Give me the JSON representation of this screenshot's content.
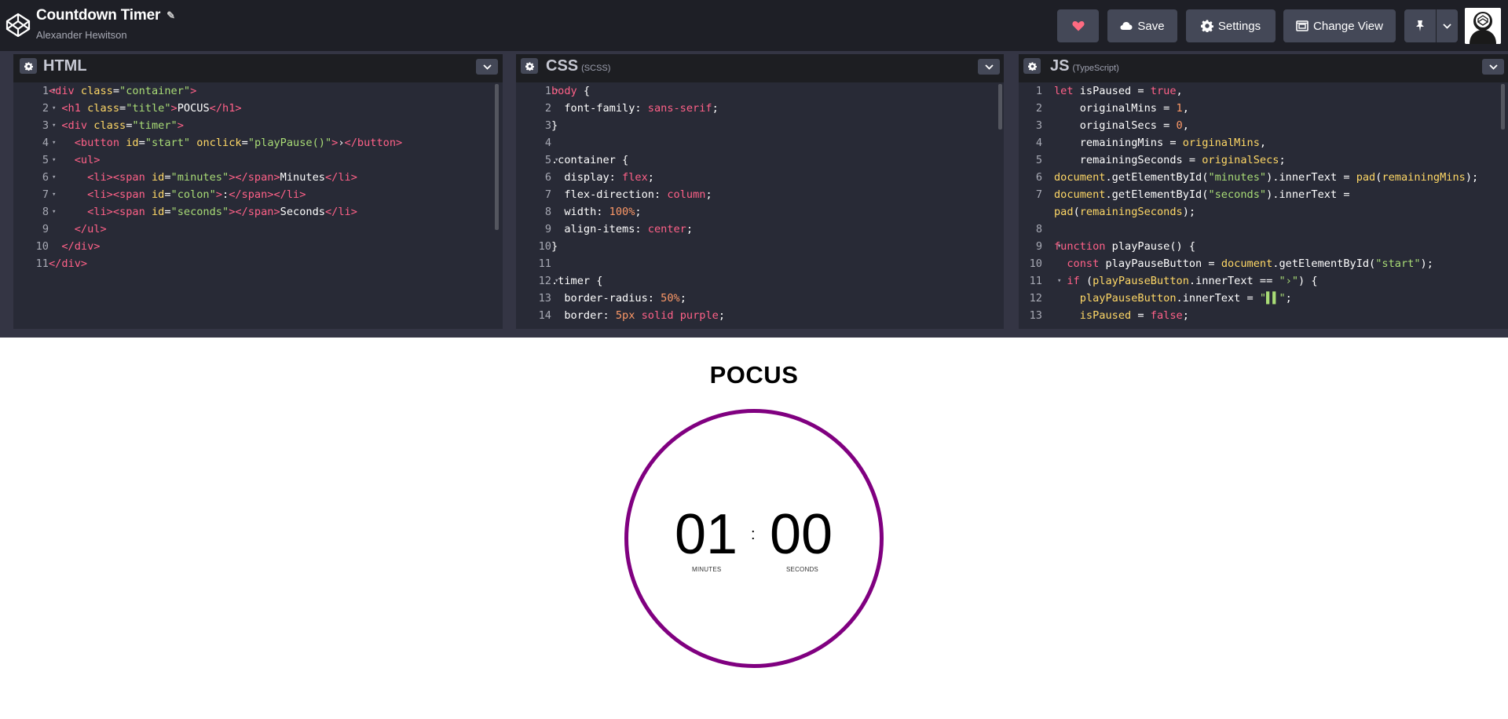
{
  "header": {
    "pen_title": "Countdown Timer",
    "author": "Alexander Hewitson",
    "save_label": "Save",
    "settings_label": "Settings",
    "change_view_label": "Change View",
    "heart_color": "#ff6b81"
  },
  "panes": {
    "html": {
      "name": "HTML",
      "sub": ""
    },
    "css": {
      "name": "CSS",
      "sub": "(SCSS)"
    },
    "js": {
      "name": "JS",
      "sub": "(TypeScript)"
    }
  },
  "html_code": [
    {
      "n": "1",
      "fold": true,
      "segs": [
        [
          "tag",
          "<div "
        ],
        [
          "attr",
          "class"
        ],
        [
          "prop",
          "="
        ],
        [
          "str",
          "\"container\""
        ],
        [
          "tag",
          ">"
        ]
      ]
    },
    {
      "n": "2",
      "fold": true,
      "segs": [
        [
          "prop",
          "  "
        ],
        [
          "tag",
          "<h1 "
        ],
        [
          "attr",
          "class"
        ],
        [
          "prop",
          "="
        ],
        [
          "str",
          "\"title\""
        ],
        [
          "tag",
          ">"
        ],
        [
          "prop",
          "POCUS"
        ],
        [
          "tag",
          "</h1>"
        ]
      ]
    },
    {
      "n": "3",
      "fold": true,
      "segs": [
        [
          "prop",
          "  "
        ],
        [
          "tag",
          "<div "
        ],
        [
          "attr",
          "class"
        ],
        [
          "prop",
          "="
        ],
        [
          "str",
          "\"timer\""
        ],
        [
          "tag",
          ">"
        ]
      ]
    },
    {
      "n": "4",
      "fold": true,
      "segs": [
        [
          "prop",
          "    "
        ],
        [
          "tag",
          "<button "
        ],
        [
          "attr",
          "id"
        ],
        [
          "prop",
          "="
        ],
        [
          "str",
          "\"start\""
        ],
        [
          "prop",
          " "
        ],
        [
          "attr",
          "onclick"
        ],
        [
          "prop",
          "="
        ],
        [
          "str",
          "\"playPause()\""
        ],
        [
          "tag",
          ">"
        ],
        [
          "prop",
          "›"
        ],
        [
          "tag",
          "</button>"
        ]
      ]
    },
    {
      "n": "5",
      "fold": true,
      "segs": [
        [
          "prop",
          "    "
        ],
        [
          "tag",
          "<ul>"
        ]
      ]
    },
    {
      "n": "6",
      "fold": true,
      "segs": [
        [
          "prop",
          "      "
        ],
        [
          "tag",
          "<li><span "
        ],
        [
          "attr",
          "id"
        ],
        [
          "prop",
          "="
        ],
        [
          "str",
          "\"minutes\""
        ],
        [
          "tag",
          "></span>"
        ],
        [
          "prop",
          "Minutes"
        ],
        [
          "tag",
          "</li>"
        ]
      ]
    },
    {
      "n": "7",
      "fold": true,
      "segs": [
        [
          "prop",
          "      "
        ],
        [
          "tag",
          "<li><span "
        ],
        [
          "attr",
          "id"
        ],
        [
          "prop",
          "="
        ],
        [
          "str",
          "\"colon\""
        ],
        [
          "tag",
          ">"
        ],
        [
          "prop",
          ":"
        ],
        [
          "tag",
          "</span></li>"
        ]
      ]
    },
    {
      "n": "8",
      "fold": true,
      "segs": [
        [
          "prop",
          "      "
        ],
        [
          "tag",
          "<li><span "
        ],
        [
          "attr",
          "id"
        ],
        [
          "prop",
          "="
        ],
        [
          "str",
          "\"seconds\""
        ],
        [
          "tag",
          "></span>"
        ],
        [
          "prop",
          "Seconds"
        ],
        [
          "tag",
          "</li>"
        ]
      ]
    },
    {
      "n": "9",
      "fold": false,
      "segs": [
        [
          "prop",
          "    "
        ],
        [
          "tag",
          "</ul>"
        ]
      ]
    },
    {
      "n": "10",
      "fold": false,
      "segs": [
        [
          "prop",
          "  "
        ],
        [
          "tag",
          "</div>"
        ]
      ]
    },
    {
      "n": "11",
      "fold": false,
      "segs": [
        [
          "tag",
          "</div>"
        ]
      ]
    }
  ],
  "css_code": [
    {
      "n": "1",
      "fold": true,
      "segs": [
        [
          "sel",
          "body"
        ],
        [
          "prop",
          " {"
        ]
      ]
    },
    {
      "n": "2",
      "fold": false,
      "segs": [
        [
          "prop",
          "  font-family: "
        ],
        [
          "val",
          "sans-serif"
        ],
        [
          "prop",
          ";"
        ]
      ]
    },
    {
      "n": "3",
      "fold": false,
      "segs": [
        [
          "prop",
          "}"
        ]
      ]
    },
    {
      "n": "4",
      "fold": false,
      "segs": []
    },
    {
      "n": "5",
      "fold": true,
      "segs": [
        [
          "prop",
          ".container {"
        ]
      ]
    },
    {
      "n": "6",
      "fold": false,
      "segs": [
        [
          "prop",
          "  display: "
        ],
        [
          "val",
          "flex"
        ],
        [
          "prop",
          ";"
        ]
      ]
    },
    {
      "n": "7",
      "fold": false,
      "segs": [
        [
          "prop",
          "  flex-direction: "
        ],
        [
          "val",
          "column"
        ],
        [
          "prop",
          ";"
        ]
      ]
    },
    {
      "n": "8",
      "fold": false,
      "segs": [
        [
          "prop",
          "  width: "
        ],
        [
          "num",
          "100%"
        ],
        [
          "prop",
          ";"
        ]
      ]
    },
    {
      "n": "9",
      "fold": false,
      "segs": [
        [
          "prop",
          "  align-items: "
        ],
        [
          "val",
          "center"
        ],
        [
          "prop",
          ";"
        ]
      ]
    },
    {
      "n": "10",
      "fold": false,
      "segs": [
        [
          "prop",
          "}"
        ]
      ]
    },
    {
      "n": "11",
      "fold": false,
      "segs": []
    },
    {
      "n": "12",
      "fold": true,
      "segs": [
        [
          "prop",
          ".timer {"
        ]
      ]
    },
    {
      "n": "13",
      "fold": false,
      "segs": [
        [
          "prop",
          "  border-radius: "
        ],
        [
          "num",
          "50%"
        ],
        [
          "prop",
          ";"
        ]
      ]
    },
    {
      "n": "14",
      "fold": false,
      "segs": [
        [
          "prop",
          "  border: "
        ],
        [
          "num",
          "5px"
        ],
        [
          "prop",
          " "
        ],
        [
          "val",
          "solid"
        ],
        [
          "prop",
          " "
        ],
        [
          "val",
          "purple"
        ],
        [
          "prop",
          ";"
        ]
      ]
    }
  ],
  "js_code": [
    {
      "n": "1",
      "fold": false,
      "segs": [
        [
          "kw",
          "let "
        ],
        [
          "prop",
          "isPaused = "
        ],
        [
          "val",
          "true"
        ],
        [
          "prop",
          ","
        ]
      ]
    },
    {
      "n": "2",
      "fold": false,
      "segs": [
        [
          "prop",
          "    originalMins = "
        ],
        [
          "num",
          "1"
        ],
        [
          "prop",
          ","
        ]
      ]
    },
    {
      "n": "3",
      "fold": false,
      "segs": [
        [
          "prop",
          "    originalSecs = "
        ],
        [
          "num",
          "0"
        ],
        [
          "prop",
          ","
        ]
      ]
    },
    {
      "n": "4",
      "fold": false,
      "segs": [
        [
          "prop",
          "    remainingMins = "
        ],
        [
          "attr",
          "originalMins"
        ],
        [
          "prop",
          ","
        ]
      ]
    },
    {
      "n": "5",
      "fold": false,
      "segs": [
        [
          "prop",
          "    remainingSeconds = "
        ],
        [
          "attr",
          "originalSecs"
        ],
        [
          "prop",
          ";"
        ]
      ]
    },
    {
      "n": "6",
      "fold": false,
      "segs": [
        [
          "attr",
          "document"
        ],
        [
          "prop",
          ".getElementById("
        ],
        [
          "str",
          "\"minutes\""
        ],
        [
          "prop",
          ").innerText = "
        ],
        [
          "attr",
          "pad"
        ],
        [
          "prop",
          "("
        ],
        [
          "attr",
          "remainingMins"
        ],
        [
          "prop",
          ");"
        ]
      ]
    },
    {
      "n": "7",
      "fold": false,
      "segs": [
        [
          "attr",
          "document"
        ],
        [
          "prop",
          ".getElementById("
        ],
        [
          "str",
          "\"seconds\""
        ],
        [
          "prop",
          ").innerText ="
        ]
      ]
    },
    {
      "n": "",
      "fold": false,
      "segs": [
        [
          "attr",
          "pad"
        ],
        [
          "prop",
          "("
        ],
        [
          "attr",
          "remainingSeconds"
        ],
        [
          "prop",
          ");"
        ]
      ]
    },
    {
      "n": "8",
      "fold": false,
      "segs": []
    },
    {
      "n": "9",
      "fold": true,
      "segs": [
        [
          "kw",
          "function "
        ],
        [
          "prop",
          "playPause() {"
        ]
      ]
    },
    {
      "n": "10",
      "fold": false,
      "segs": [
        [
          "prop",
          "  "
        ],
        [
          "kw",
          "const "
        ],
        [
          "prop",
          "playPauseButton = "
        ],
        [
          "attr",
          "document"
        ],
        [
          "prop",
          ".getElementById("
        ],
        [
          "str",
          "\"start\""
        ],
        [
          "prop",
          ");"
        ]
      ]
    },
    {
      "n": "11",
      "fold": true,
      "segs": [
        [
          "prop",
          "  "
        ],
        [
          "kw",
          "if "
        ],
        [
          "prop",
          "("
        ],
        [
          "attr",
          "playPauseButton"
        ],
        [
          "prop",
          ".innerText == "
        ],
        [
          "str",
          "\"›\""
        ],
        [
          "prop",
          ") {"
        ]
      ]
    },
    {
      "n": "12",
      "fold": false,
      "segs": [
        [
          "prop",
          "    "
        ],
        [
          "attr",
          "playPauseButton"
        ],
        [
          "prop",
          ".innerText = "
        ],
        [
          "str",
          "\"▌▌\""
        ],
        [
          "prop",
          ";"
        ]
      ]
    },
    {
      "n": "13",
      "fold": false,
      "segs": [
        [
          "prop",
          "    "
        ],
        [
          "attr",
          "isPaused"
        ],
        [
          "prop",
          " = "
        ],
        [
          "val",
          "false"
        ],
        [
          "prop",
          ";"
        ]
      ]
    }
  ],
  "preview": {
    "title": "POCUS",
    "minutes": "01",
    "colon": ":",
    "seconds": "00",
    "minutes_label": "MINUTES",
    "seconds_label": "SECONDS",
    "ring_color": "#800080"
  }
}
